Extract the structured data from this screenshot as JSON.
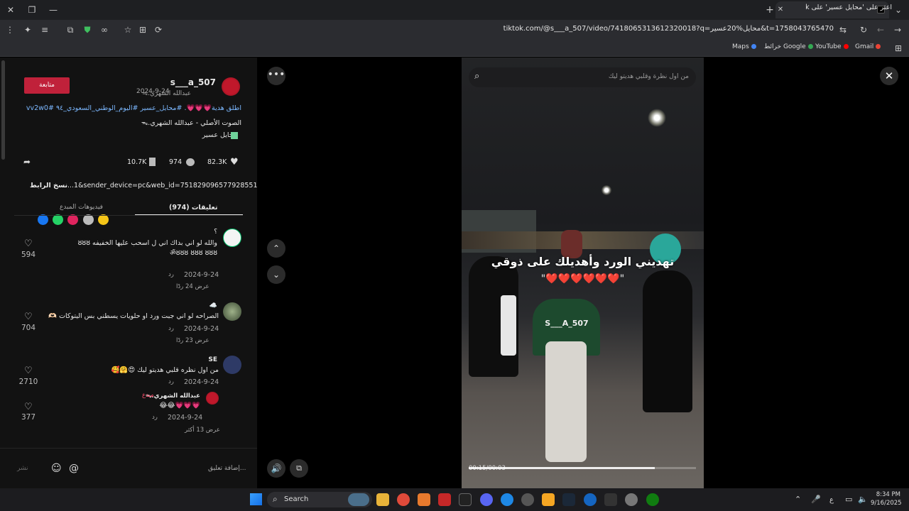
{
  "browser": {
    "tab_title": "اعثر على 'محايل عسير' على TikTok",
    "url": "tiktok.com/@s___a_507/video/7418065313612320018?q=محايل%20عسير&t=1758043765470",
    "bookmarks": [
      {
        "label": "Gmail",
        "color": "#ea4335"
      },
      {
        "label": "YouTube",
        "color": "#ff0000"
      },
      {
        "label": "خرائط Google",
        "color": "#34a853"
      },
      {
        "label": "Maps",
        "color": "#4285f4"
      }
    ]
  },
  "post": {
    "username": "s___a_507",
    "display_name": "عبدالله الشهري‪ᯓ.",
    "date": "2024-9-24",
    "follow_label": "متابعة",
    "caption": "اطلق هدية💗💗💗. #محايل_عسير #اليوم_الوطني_السعودي_٩٤ #vv2w0",
    "sound": "الصوت الأصلي - عبدالله الشهري‪ᯓ.",
    "location": "محايل عسير",
    "likes": "82.3K",
    "comments": "974",
    "saves": "10.7K",
    "share_url": "...1&sender_device=pc&web_id=7518290965779285512",
    "copy_link_label": "نسخ الرابط",
    "tabs": [
      "تعليقات (974)",
      "فيديوهات المبدع"
    ]
  },
  "comments": [
    {
      "author": "؟",
      "text": "والله لو اني بداك اني ل اسحب عليها الخفيفه ȣȣȣ ॐȣȣȣ ȣȣȣ ȣȣȣ",
      "date": "2024-9-24",
      "reply": "رد",
      "replies": "عرض 24 ردًا",
      "likes": "594"
    },
    {
      "author": "☁️",
      "text": "الصراحه لو اني جبت ورد او حلويات يسطني بس اليتوكات 🫶🏻",
      "date": "2024-9-24",
      "reply": "رد",
      "replies": "عرض 23 ردًا",
      "likes": "704"
    },
    {
      "author": "SE",
      "text": "من اول نظره قلبي هديتو ليك 😍🤗🥰",
      "date": "2024-9-24",
      "reply": "رد",
      "replies": "",
      "likes": "2710"
    },
    {
      "author": "عبدالله الشهري‪ᯓ.",
      "badge": "مبدع",
      "text": "😂😂💗💗💗",
      "date": "2024-9-24",
      "reply": "رد",
      "replies": "عرض 13 أكثر",
      "likes": "377"
    }
  ],
  "composer": {
    "placeholder": "إضافة تعليق...",
    "post_label": "نشر"
  },
  "video": {
    "search_placeholder": "من اول نظرة وقلبي هديتو ليك",
    "overlay_text": "تهديني الورد وأهديلك على ذوقي",
    "hearts": "\"❤️❤️❤️❤️❤️❤️\"",
    "shirt_text": "S___A_507",
    "time": "00:15/00:03",
    "progress": 0.82
  },
  "taskbar": {
    "search_label": "Search",
    "time": "8:34 PM",
    "date": "9/16/2025",
    "lang": "ع"
  }
}
